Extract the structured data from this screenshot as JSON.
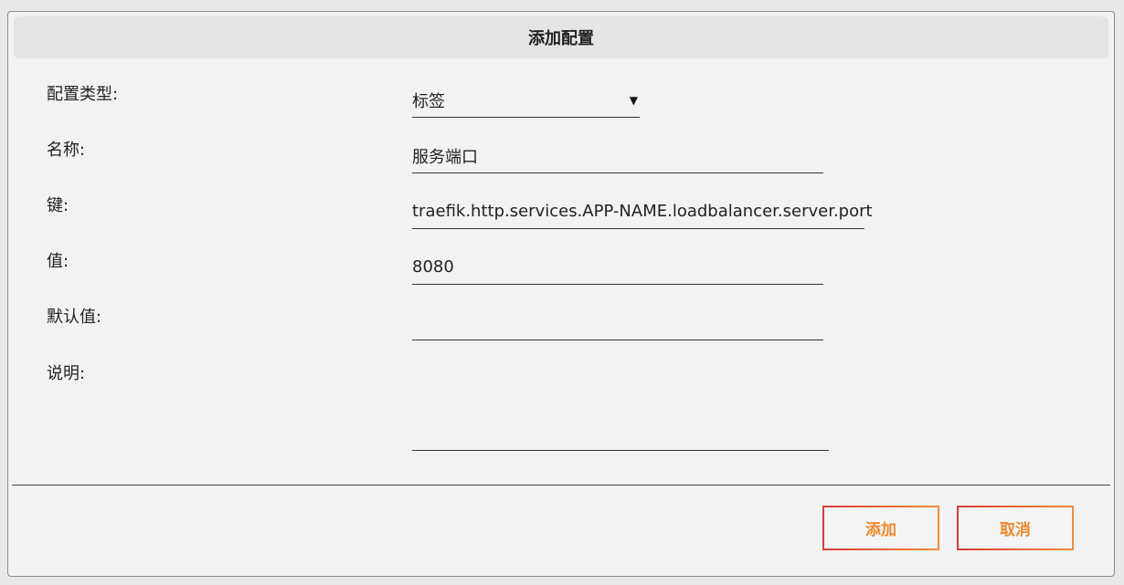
{
  "dialog": {
    "title": "添加配置"
  },
  "form": {
    "type_label": "配置类型:",
    "type_value": "标签",
    "name_label": "名称:",
    "name_value": "服务端口",
    "key_label": "键:",
    "key_value": "traefik.http.services.APP-NAME.loadbalancer.server.port",
    "value_label": "值:",
    "value_value": "8080",
    "default_label": "默认值:",
    "default_value": "",
    "desc_label": "说明:",
    "desc_value": ""
  },
  "icons": {
    "select_caret": "▼"
  },
  "buttons": {
    "add_label": "添加",
    "cancel_label": "取消"
  },
  "colors": {
    "button_text": "#f0872e",
    "button_border_start": "#d83a3a",
    "button_border_end": "#f08d38"
  }
}
